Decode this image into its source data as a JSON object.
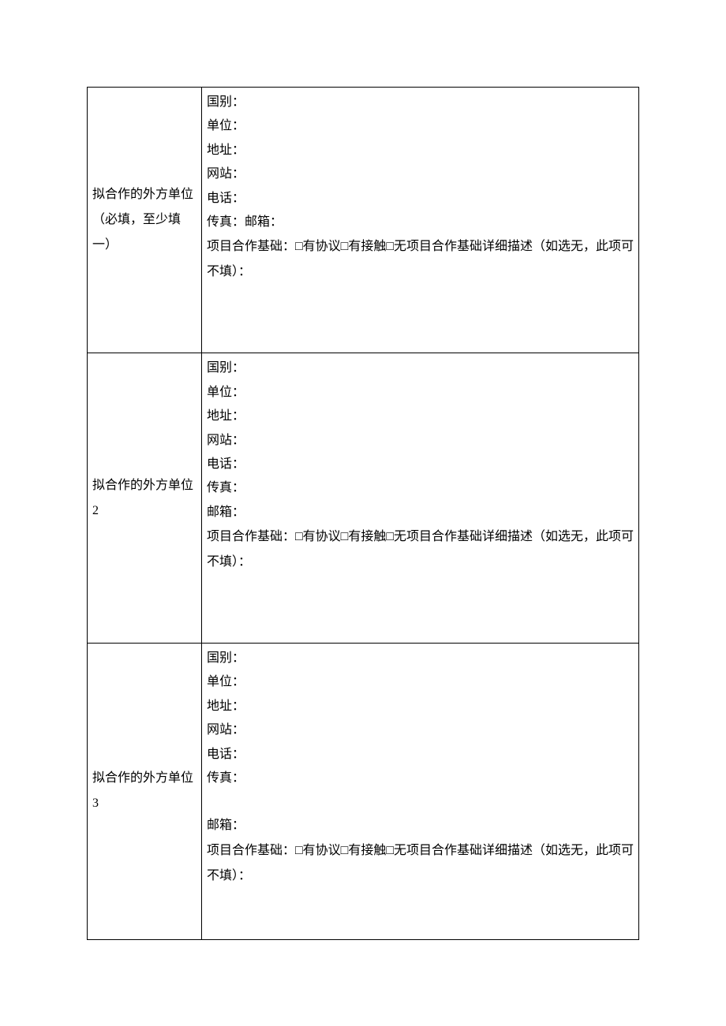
{
  "rows": [
    {
      "label": "拟合作的外方单位（必填，至少填一）",
      "fields": {
        "country": "国别：",
        "org": "单位：",
        "address": "地址：",
        "website": "网站：",
        "phone": "电话：",
        "fax_email": "传真：邮箱：",
        "basis": "项目合作基础：□有协议□有接触□无项目合作基础详细描述（如选无，此项可不填）："
      }
    },
    {
      "label": "拟合作的外方单位 2",
      "fields": {
        "country": "国别：",
        "org": "单位：",
        "address": "地址：",
        "website": "网站：",
        "phone": "电话：",
        "fax": "传真：",
        "email": "邮箱：",
        "basis": "项目合作基础：□有协议□有接触□无项目合作基础详细描述（如选无，此项可不填）："
      }
    },
    {
      "label": "拟合作的外方单位 3",
      "fields": {
        "country": "国别：",
        "org": "单位：",
        "address": "地址：",
        "website": "网站：",
        "phone": "电话：",
        "fax": "传真：",
        "email": "邮箱：",
        "basis": "项目合作基础：□有协议□有接触□无项目合作基础详细描述（如选无，此项可不填）："
      }
    }
  ]
}
